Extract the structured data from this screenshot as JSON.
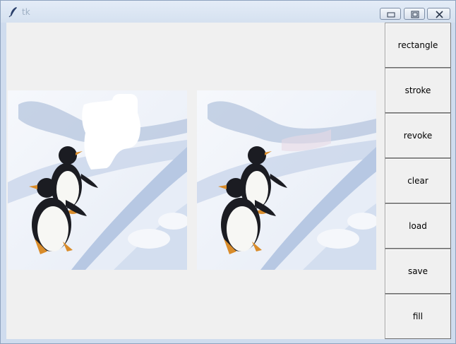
{
  "window": {
    "title": "tk",
    "app_icon": "feather-icon",
    "controls": [
      "minimize-icon",
      "maximize-icon",
      "close-icon"
    ]
  },
  "toolbar": {
    "rectangle_label": "rectangle",
    "stroke_label": "stroke",
    "revoke_label": "revoke",
    "clear_label": "clear",
    "load_label": "load",
    "save_label": "save",
    "fill_label": "fill"
  },
  "canvases": {
    "left": {
      "content": "original image with white masked region"
    },
    "right": {
      "content": "inpainted result image"
    }
  },
  "colors": {
    "window_bg": "#f0f0f0",
    "titlebar": "#d5e1f0",
    "snow": "#f3f6fb",
    "snow_shadow": "#a9bbd8",
    "penguin_black": "#1b1c22",
    "penguin_white": "#f7f7f4",
    "penguin_orange": "#d98c2a"
  }
}
